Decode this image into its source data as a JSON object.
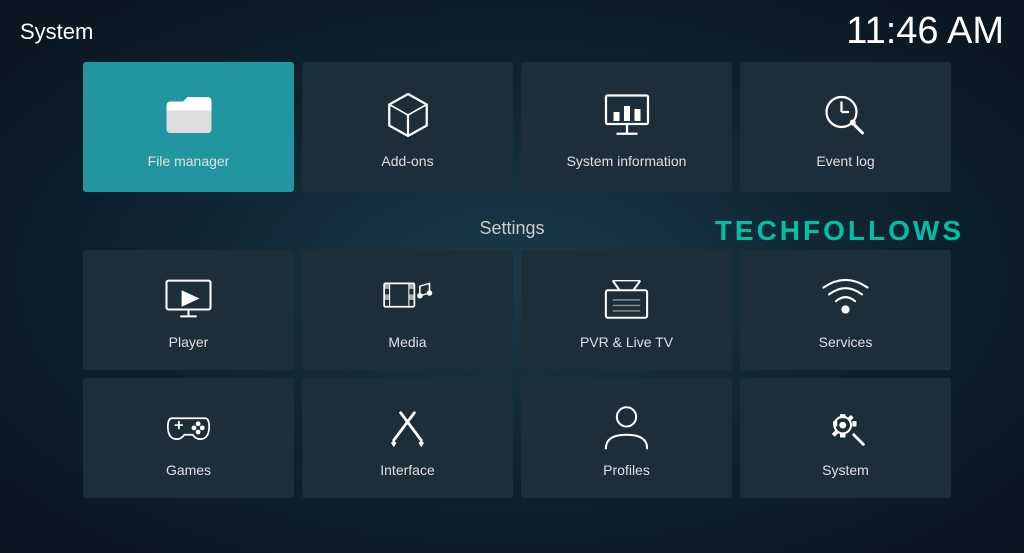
{
  "header": {
    "title": "System",
    "time": "11:46 AM"
  },
  "watermark": "TECHFOLLOWS",
  "top_row": [
    {
      "id": "file-manager",
      "label": "File manager",
      "active": true
    },
    {
      "id": "add-ons",
      "label": "Add-ons",
      "active": false
    },
    {
      "id": "system-information",
      "label": "System information",
      "active": false
    },
    {
      "id": "event-log",
      "label": "Event log",
      "active": false
    }
  ],
  "settings_label": "Settings",
  "settings_grid": [
    {
      "id": "player",
      "label": "Player"
    },
    {
      "id": "media",
      "label": "Media"
    },
    {
      "id": "pvr-live-tv",
      "label": "PVR & Live TV"
    },
    {
      "id": "services",
      "label": "Services"
    },
    {
      "id": "games",
      "label": "Games"
    },
    {
      "id": "interface",
      "label": "Interface"
    },
    {
      "id": "profiles",
      "label": "Profiles"
    },
    {
      "id": "system",
      "label": "System"
    }
  ]
}
